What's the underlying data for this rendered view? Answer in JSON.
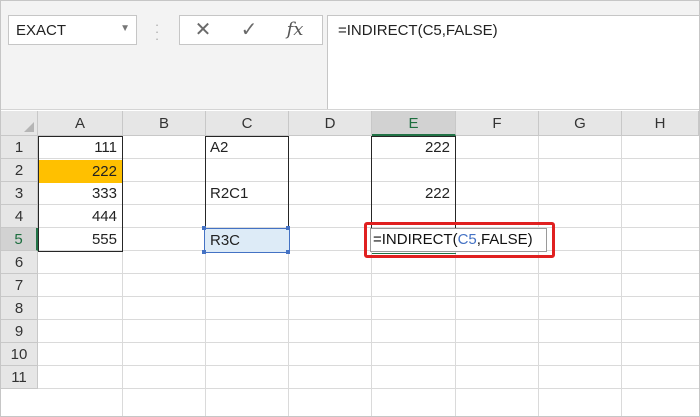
{
  "name_box": {
    "value": "EXACT"
  },
  "formula_bar": {
    "cancel_glyph": "✕",
    "enter_glyph": "✓",
    "fx_glyph": "fx",
    "formula": "=INDIRECT(C5,FALSE)"
  },
  "columns": [
    "A",
    "B",
    "C",
    "D",
    "E",
    "F",
    "G",
    "H"
  ],
  "rows": [
    "1",
    "2",
    "3",
    "4",
    "5",
    "6",
    "7",
    "8",
    "9",
    "10",
    "11"
  ],
  "selected_column": "E",
  "selected_row": "5",
  "cells": {
    "A1": "111",
    "A2": "222",
    "A3": "333",
    "A4": "444",
    "A5": "555",
    "C1": "A2",
    "C3": "R2C1",
    "C5": "R3C",
    "E1": "222",
    "E3": "222"
  },
  "edit_cell": {
    "address": "E5",
    "prefix": "=INDIRECT(",
    "ref": "C5",
    "suffix": ",FALSE)"
  },
  "colors": {
    "highlight_fill": "#ffc000",
    "reference_blue": "#4472c4",
    "annotation_red": "#e02020",
    "excel_green": "#217346"
  }
}
